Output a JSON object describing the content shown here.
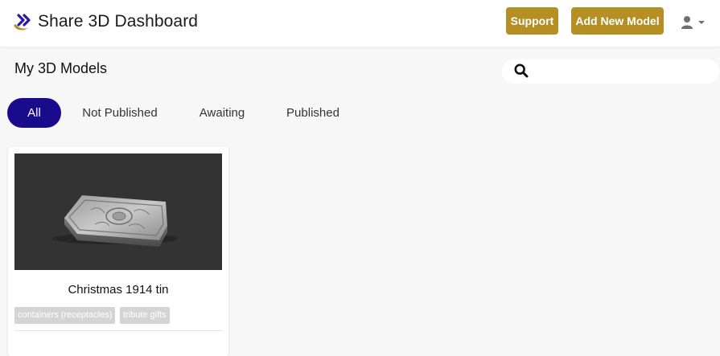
{
  "header": {
    "title": "Share 3D Dashboard",
    "support_label": "Support",
    "add_model_label": "Add New Model",
    "accent_color": "#b58f24"
  },
  "main": {
    "page_title": "My 3D Models",
    "search": {
      "value": "",
      "placeholder": ""
    },
    "tabs": [
      {
        "label": "All",
        "active": true
      },
      {
        "label": "Not Published",
        "active": false
      },
      {
        "label": "Awaiting",
        "active": false
      },
      {
        "label": "Published",
        "active": false
      }
    ],
    "active_tab_color": "#1a0a8c",
    "models": [
      {
        "title": "Christmas 1914 tin",
        "tags": [
          "containers (receptacles)",
          "tribute gifts"
        ]
      }
    ]
  }
}
